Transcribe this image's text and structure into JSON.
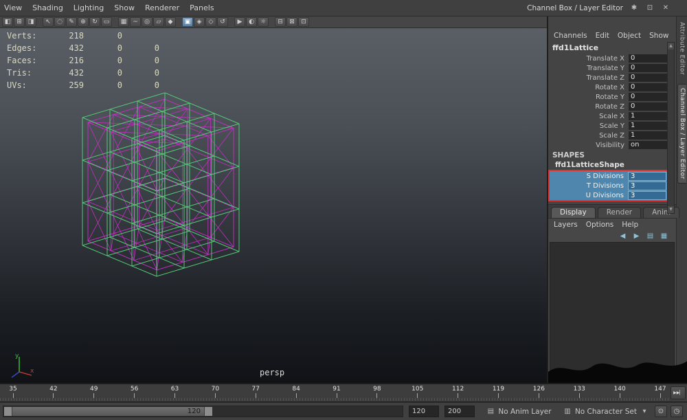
{
  "menubar": {
    "menus": [
      "View",
      "Shading",
      "Lighting",
      "Show",
      "Renderer",
      "Panels"
    ],
    "panel_title": "Channel Box / Layer Editor"
  },
  "icons": {
    "panel_options": "✱",
    "float_panel": "⊡",
    "close_panel": "✕",
    "anim_layer": "▤",
    "character_set": "▥",
    "chevron": "▾",
    "autokey": "⊙",
    "anim_prefs": "◷",
    "go_to_end": "▶▶▏",
    "scroll_up": "▲",
    "scroll_down": "▼"
  },
  "toolbar": {
    "icons": [
      {
        "name": "single-pane-layout-icon",
        "glyph": "◧"
      },
      {
        "name": "four-pane-layout-icon",
        "glyph": "⊞"
      },
      {
        "name": "hypershade-layout-icon",
        "glyph": "◨"
      },
      {
        "name": "toolbar-separator",
        "glyph": "",
        "state": "sep"
      },
      {
        "name": "select-tool-icon",
        "glyph": "↖"
      },
      {
        "name": "lasso-tool-icon",
        "glyph": "◌"
      },
      {
        "name": "paint-select-tool-icon",
        "glyph": "✎"
      },
      {
        "name": "move-tool-icon",
        "glyph": "⊕"
      },
      {
        "name": "rotate-tool-icon",
        "glyph": "↻"
      },
      {
        "name": "scale-tool-icon",
        "glyph": "▭"
      },
      {
        "name": "toolbar-separator",
        "glyph": "",
        "state": "sep"
      },
      {
        "name": "snap-to-grid-icon",
        "glyph": "▦"
      },
      {
        "name": "snap-to-curve-icon",
        "glyph": "~"
      },
      {
        "name": "snap-to-point-icon",
        "glyph": "◎"
      },
      {
        "name": "snap-to-plane-icon",
        "glyph": "▱"
      },
      {
        "name": "make-live-icon",
        "glyph": "◆"
      },
      {
        "name": "toolbar-separator",
        "glyph": "",
        "state": "sep"
      },
      {
        "name": "selection-highlight-icon",
        "glyph": "▣",
        "state": "active"
      },
      {
        "name": "input-connections-icon",
        "glyph": "◈"
      },
      {
        "name": "output-connections-icon",
        "glyph": "◇"
      },
      {
        "name": "construction-history-icon",
        "glyph": "↺"
      },
      {
        "name": "toolbar-separator",
        "glyph": "",
        "state": "sep"
      },
      {
        "name": "render-frame-icon",
        "glyph": "▶"
      },
      {
        "name": "ipr-render-icon",
        "glyph": "◐"
      },
      {
        "name": "render-settings-icon",
        "glyph": "☼"
      },
      {
        "name": "toolbar-separator",
        "glyph": "",
        "state": "sep"
      },
      {
        "name": "counter-display-icon",
        "glyph": "⊟"
      },
      {
        "name": "script-editor-icon",
        "glyph": "⊠"
      },
      {
        "name": "command-line-icon",
        "glyph": "⊡"
      }
    ]
  },
  "hud": {
    "rows": [
      {
        "label": "Verts:",
        "values": [
          "218",
          "0",
          ""
        ]
      },
      {
        "label": "Edges:",
        "values": [
          "432",
          "0",
          "0"
        ]
      },
      {
        "label": "Faces:",
        "values": [
          "216",
          "0",
          "0"
        ]
      },
      {
        "label": "Tris:",
        "values": [
          "432",
          "0",
          "0"
        ]
      },
      {
        "label": "UVs:",
        "values": [
          "259",
          "0",
          "0"
        ]
      }
    ]
  },
  "viewport": {
    "camera_label": "persp",
    "axis_labels": {
      "x": "x",
      "y": "y"
    }
  },
  "lattice": {
    "divisions": 3,
    "origin": [
      228,
      361
    ],
    "axis_u": [
      40,
      -12
    ],
    "axis_v": [
      -36,
      -15
    ],
    "axis_w": 62,
    "inner_scale": 0.93,
    "lattice_color": "#55c878",
    "wire_color": "#c12fc1"
  },
  "channel_box": {
    "menus": [
      "Channels",
      "Edit",
      "Object",
      "Show"
    ],
    "node_name": "ffd1Lattice",
    "attributes": [
      {
        "label": "Translate X",
        "value": "0"
      },
      {
        "label": "Translate Y",
        "value": "0"
      },
      {
        "label": "Translate Z",
        "value": "0"
      },
      {
        "label": "Rotate X",
        "value": "0"
      },
      {
        "label": "Rotate Y",
        "value": "0"
      },
      {
        "label": "Rotate Z",
        "value": "0"
      },
      {
        "label": "Scale X",
        "value": "1"
      },
      {
        "label": "Scale Y",
        "value": "1"
      },
      {
        "label": "Scale Z",
        "value": "1"
      },
      {
        "label": "Visibility",
        "value": "on"
      }
    ],
    "shapes_header": "SHAPES",
    "shape_name": "ffd1LatticeShape",
    "shape_attributes": [
      {
        "label": "S Divisions",
        "value": "3"
      },
      {
        "label": "T Divisions",
        "value": "3"
      },
      {
        "label": "U Divisions",
        "value": "3"
      }
    ]
  },
  "layer_editor": {
    "tabs": [
      {
        "label": "Display",
        "state": "active"
      },
      {
        "label": "Render",
        "state": ""
      },
      {
        "label": "Anim",
        "state": ""
      }
    ],
    "menus": [
      "Layers",
      "Options",
      "Help"
    ],
    "icons": [
      {
        "name": "layer-prev-icon",
        "glyph": "◀"
      },
      {
        "name": "layer-next-icon",
        "glyph": "▶"
      },
      {
        "name": "new-empty-layer-icon",
        "glyph": "▤"
      },
      {
        "name": "new-layer-from-selected-icon",
        "glyph": "▦"
      }
    ]
  },
  "side_tabs": {
    "tabs": [
      {
        "label": "Attribute Editor",
        "state": ""
      },
      {
        "label": "Channel Box / Layer Editor",
        "state": "active"
      }
    ]
  },
  "timeline": {
    "ticks": [
      "35",
      "42",
      "49",
      "56",
      "63",
      "70",
      "77",
      "84",
      "91",
      "98",
      "105",
      "112",
      "119",
      "126",
      "133",
      "140",
      "147"
    ]
  },
  "range_bar": {
    "bar_value": "120",
    "start_value": "120",
    "end_value": "200",
    "anim_layer_label": "No Anim Layer",
    "character_set_label": "No Character Set"
  }
}
